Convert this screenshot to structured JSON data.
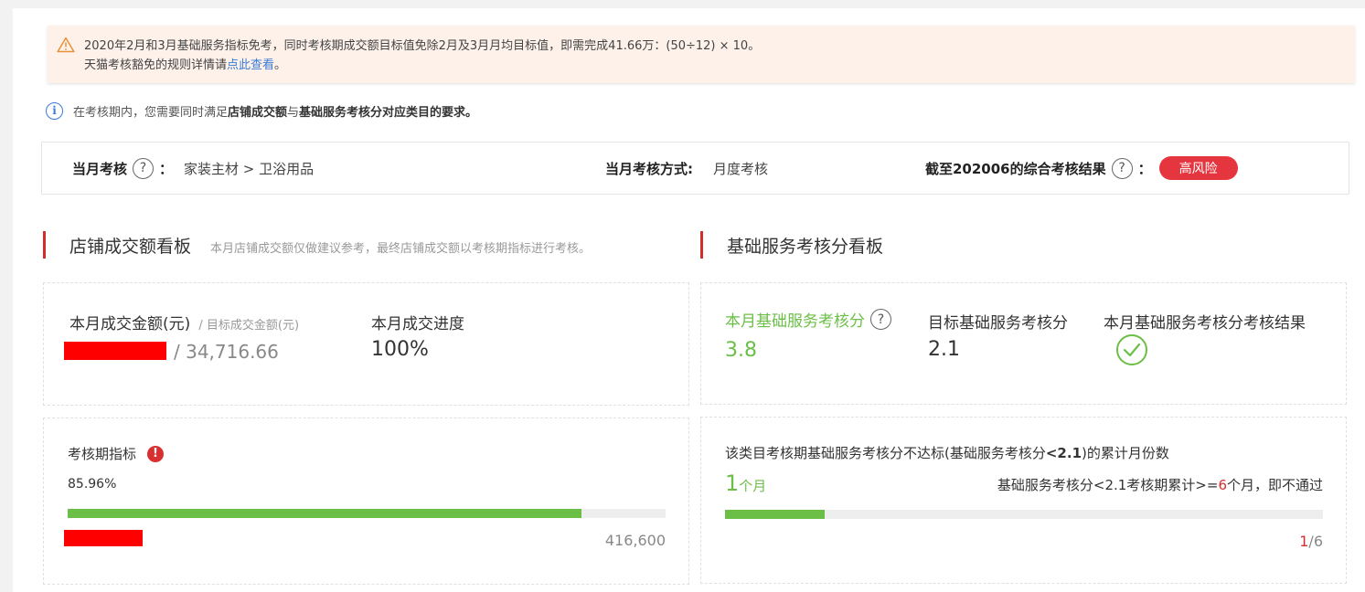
{
  "notice": {
    "line1": "2020年2月和3月基础服务指标免考，同时考核期成交额目标值免除2月及3月月均目标值，即需完成41.66万：(50÷12) × 10。",
    "line2_prefix": "天猫考核豁免的规则详情请",
    "line2_link": "点此查看",
    "line2_suffix": "。",
    "icon": "warning-icon",
    "color": "#fdf1ea"
  },
  "info": {
    "icon": "info-icon",
    "text_prefix": "在考核期内，您需要同时满足",
    "bold1": "店铺成交额",
    "text_mid": "与",
    "bold2": "基础服务考核分对应类目的要求。"
  },
  "assessment": {
    "current_label": "当月考核",
    "current_colon": "：",
    "category": "家装主材 > 卫浴用品",
    "method_label": "当月考核方式:",
    "method_value": "月度考核",
    "result_label": "截至202006的综合考核结果",
    "result_colon": "：",
    "result_badge": "高风险",
    "badge_color": "#e5353f"
  },
  "sales_board": {
    "title": "店铺成交额看板",
    "subtitle": "本月店铺成交额仅做建议参考，最终店铺成交额以考核期指标进行考核。",
    "amount_label": "本月成交金额(元)",
    "target_label": "/ 目标成交金额(元)",
    "target_value": "/ 34,716.66",
    "progress_label": "本月成交进度",
    "progress_value": "100%",
    "period_label": "考核期指标",
    "period_percent": "85.96%",
    "period_progress": 0.8596,
    "period_target": "416,600"
  },
  "service_board": {
    "title": "基础服务考核分看板",
    "score_label": "本月基础服务考核分",
    "score_value": "3.8",
    "target_label": "目标基础服务考核分",
    "target_value": "2.1",
    "result_label": "本月基础服务考核分考核结果",
    "result_icon": "check-circle-icon",
    "cumulative_label": "该类目考核期基础服务考核分不达标(基础服务考核分",
    "cumulative_bold": "<2.1",
    "cumulative_suffix": ")的累计月份数",
    "months_count": "1",
    "months_unit": "个月",
    "rule_prefix": "基础服务考核分<2.1考核期累计>=",
    "rule_number": "6",
    "rule_suffix": "个月，即不通过",
    "progress": 0.1667,
    "ratio_current": "1",
    "ratio_total": "/6",
    "accent_green": "#6bbf47",
    "accent_red": "#d42d2d"
  }
}
